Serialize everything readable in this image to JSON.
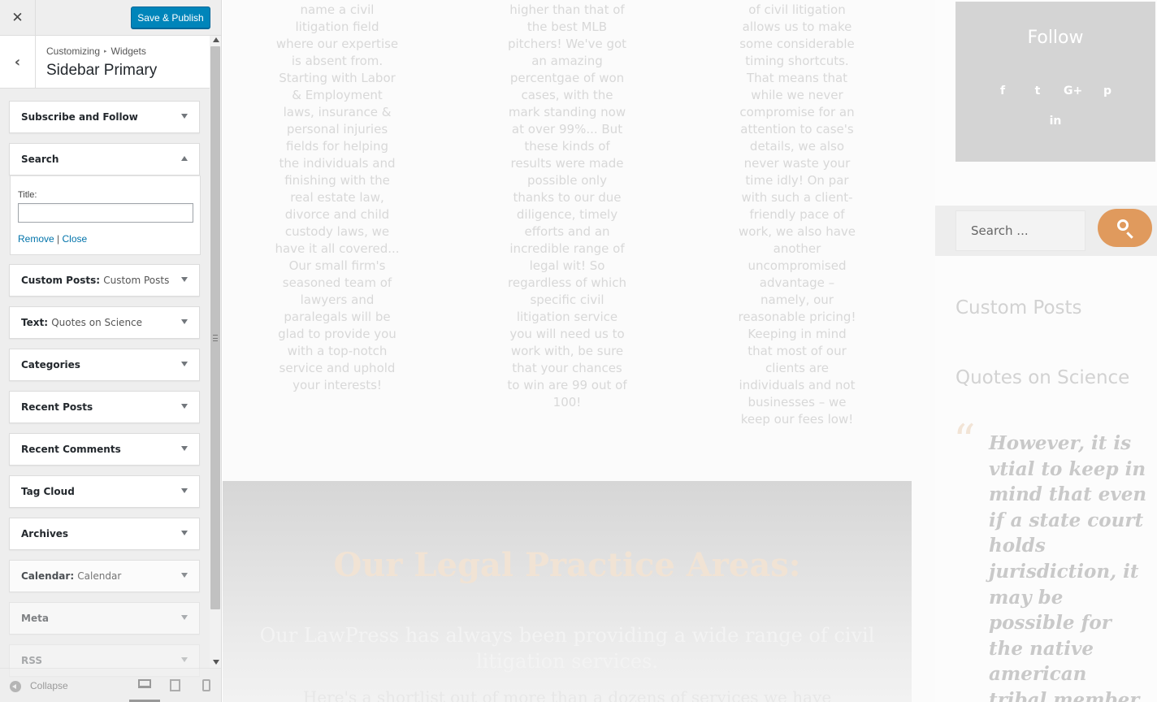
{
  "customizer": {
    "close_icon": "close-icon",
    "publish_label": "Save & Publish",
    "back_icon": "chevron-left-icon",
    "breadcrumb": {
      "root": "Customizing",
      "sep": "▸",
      "current": "Widgets"
    },
    "section_title": "Sidebar Primary",
    "widgets": [
      {
        "title": "Subscribe and Follow",
        "sub": "",
        "expanded": false
      },
      {
        "title": "Search",
        "sub": "",
        "expanded": true
      },
      {
        "title": "Custom Posts",
        "sub": "Custom Posts",
        "expanded": false
      },
      {
        "title": "Text",
        "sub": "Quotes on Science",
        "expanded": false
      },
      {
        "title": "Categories",
        "sub": "",
        "expanded": false
      },
      {
        "title": "Recent Posts",
        "sub": "",
        "expanded": false
      },
      {
        "title": "Recent Comments",
        "sub": "",
        "expanded": false
      },
      {
        "title": "Tag Cloud",
        "sub": "",
        "expanded": false
      },
      {
        "title": "Archives",
        "sub": "",
        "expanded": false
      },
      {
        "title": "Calendar",
        "sub": "Calendar",
        "expanded": false
      },
      {
        "title": "Meta",
        "sub": "",
        "expanded": false
      },
      {
        "title": "RSS",
        "sub": "",
        "expanded": false
      }
    ],
    "search_widget": {
      "title_label": "Title:",
      "title_value": "",
      "remove": "Remove",
      "divider": "|",
      "close": "Close"
    },
    "footer": {
      "collapse_label": "Collapse",
      "devices": [
        "desktop-icon",
        "tablet-icon",
        "mobile-icon"
      ]
    }
  },
  "preview": {
    "columns": [
      {
        "lines": [
          "name a civil",
          "litigation field",
          "where our expertise",
          "is absent from.",
          "Starting with Labor",
          "& Employment",
          "laws, insurance &",
          "personal injuries",
          "fields for helping",
          "the individuals and",
          "finishing with the",
          "real estate law,",
          "divorce and child",
          "custody laws, we",
          "have it all covered...",
          "Our small firm's",
          "seasoned team of",
          "lawyers and",
          "paralegals will be",
          "glad to provide you",
          "with a top-notch",
          "service and uphold",
          "your interests!"
        ]
      },
      {
        "lines": [
          "higher than that of",
          "the best MLB",
          "pitchers! We've got",
          "an amazing",
          "percentgae of won",
          "cases, with the",
          "mark standing now",
          "at over 99%... But",
          "these kinds of",
          "results were made",
          "possible only",
          "thanks to our due",
          "diligence, timely",
          "efforts and an",
          "incredible range of",
          "legal wit! So",
          "regardless of which",
          "specific civil",
          "litigation service",
          "you will need us to",
          "work with, be sure",
          "that your chances",
          "to win are 99 out of",
          "100!"
        ]
      },
      {
        "lines": [
          "of civil litigation",
          "allows us to make",
          "some considerable",
          "timing shortcuts.",
          "That means that",
          "while we never",
          "compromise for an",
          "attention to case's",
          "details, we also",
          "never waste your",
          "time idly! On par",
          "with such a client-",
          "friendly pace of",
          "work, we also have",
          "another",
          "uncompromised",
          "advantage –",
          "namely, our",
          "reasonable pricing!",
          "Keeping in mind",
          "that most of our",
          "clients are",
          "individuals and not",
          "businesses – we",
          "keep our fees low!"
        ]
      }
    ],
    "band": {
      "heading": "Our Legal Practice Areas:",
      "lead": "Our LawPress has always been providing a wide range of civil litigation services.",
      "next_line": "Here's a shortlist out of more than a dozens of services we have"
    },
    "sidebar": {
      "follow_title": "Follow",
      "social_icons": [
        "facebook-icon",
        "twitter-icon",
        "google-plus-icon",
        "pinterest-icon",
        "linkedin-icon"
      ],
      "social_glyphs": [
        "f",
        "t",
        "G+",
        "p",
        "in"
      ],
      "search_placeholder": "Search ...",
      "search_icon": "search-icon",
      "custom_posts_title": "Custom Posts",
      "quotes_title": "Quotes on Science",
      "quote_mark": "“",
      "quote_lines": [
        "However, it is",
        "vtial to keep in",
        "mind that even",
        "if a state court",
        "holds",
        "jurisdiction, it",
        "may be",
        "possible for",
        "the native",
        "american",
        "tribal member"
      ]
    },
    "colors": {
      "accent": "#e09a5d",
      "publish": "#0085ba",
      "link": "#0073aa"
    }
  }
}
